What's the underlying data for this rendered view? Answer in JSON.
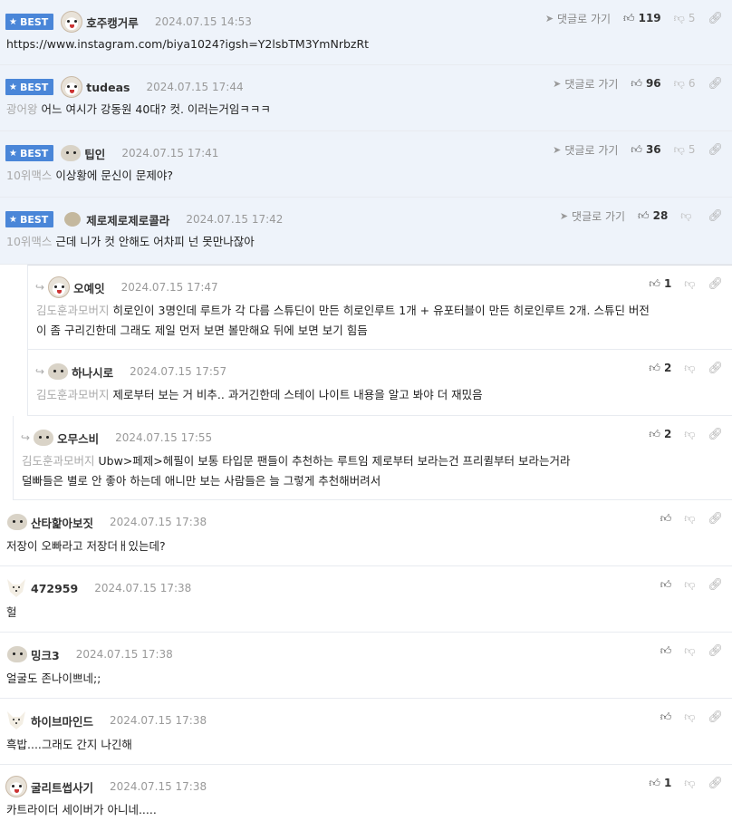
{
  "comments": [
    {
      "best": true,
      "nick": "호주캥거루",
      "date": "2024.07.15 14:53",
      "goto": "댓글로 가기",
      "up": "119",
      "down": "5",
      "tag": "",
      "text": "https://www.instagram.com/biya1024?igsh=Y2lsbTM3YmNrbzRt",
      "text2": ""
    },
    {
      "best": true,
      "nick": "tudeas",
      "date": "2024.07.15 17:44",
      "goto": "댓글로 가기",
      "up": "96",
      "down": "6",
      "tag": "광어왕",
      "text": "어느 여시가 강동원 40대? 컷. 이러는거임ㅋㅋㅋ",
      "text2": ""
    },
    {
      "best": true,
      "nick": "팁인",
      "date": "2024.07.15 17:41",
      "goto": "댓글로 가기",
      "up": "36",
      "down": "5",
      "tag": "10위맥스",
      "text": "이상황에 문신이 문제야?",
      "text2": ""
    },
    {
      "best": true,
      "nick": "제로제로제로콜라",
      "date": "2024.07.15 17:42",
      "goto": "댓글로 가기",
      "up": "28",
      "down": "",
      "tag": "10위맥스",
      "text": "근데 니가 컷 안해도 어차피 넌 못만나잖아",
      "text2": ""
    },
    {
      "best": false,
      "nick": "오예잇",
      "date": "2024.07.15 17:47",
      "goto": "",
      "up": "1",
      "down": "",
      "tag": "김도훈과모버지",
      "text": "히로인이 3명인데 루트가 각 다름 스튜딘이 만든 히로인루트 1개 + 유포터블이 만든 히로인루트 2개. 스튜딘 버전",
      "text2": "이 좀 구리긴한데 그래도 제일 먼저 보면 볼만해요 뒤에 보면 보기 힘듬"
    },
    {
      "best": false,
      "nick": "하나시로",
      "date": "2024.07.15 17:57",
      "goto": "",
      "up": "2",
      "down": "",
      "tag": "김도훈과모버지",
      "text": "제로부터 보는 거 비추.. 과거긴한데 스테이 나이트 내용을 알고 봐야 더 재밌음",
      "text2": ""
    },
    {
      "best": false,
      "nick": "오무스비",
      "date": "2024.07.15 17:55",
      "goto": "",
      "up": "2",
      "down": "",
      "tag": "김도훈과모버지",
      "text": "Ubw>페제>헤필이 보통 타입문 팬들이 추천하는 루트임 제로부터 보라는건 프리퀼부터 보라는거라",
      "text2": "덜빠들은 별로 안 좋아 하는데 애니만 보는 사람들은 늘 그렇게 추천해버려서"
    },
    {
      "best": false,
      "nick": "산타핥아보짓",
      "date": "2024.07.15 17:38",
      "goto": "",
      "up": "",
      "down": "",
      "tag": "",
      "text": "저장이 오빠라고 저장더ㅐ있는데?",
      "text2": ""
    },
    {
      "best": false,
      "nick": "472959",
      "date": "2024.07.15 17:38",
      "goto": "",
      "up": "",
      "down": "",
      "tag": "",
      "text": "헐",
      "text2": ""
    },
    {
      "best": false,
      "nick": "밍크3",
      "date": "2024.07.15 17:38",
      "goto": "",
      "up": "",
      "down": "",
      "tag": "",
      "text": "얼굴도 존나이쁘네;;",
      "text2": ""
    },
    {
      "best": false,
      "nick": "하이브마인드",
      "date": "2024.07.15 17:38",
      "goto": "",
      "up": "",
      "down": "",
      "tag": "",
      "text": "흑밥....그래도 간지 나긴해",
      "text2": ""
    },
    {
      "best": false,
      "nick": "굴리트썹사기",
      "date": "2024.07.15 17:38",
      "goto": "",
      "up": "1",
      "down": "",
      "tag": "",
      "text": "카트라이더 세이버가 아니네.....",
      "text2": ""
    }
  ],
  "labels": {
    "best": "BEST"
  },
  "icons": {
    "up": "thumbs-up-icon",
    "down": "thumbs-down-icon",
    "link": "link-icon",
    "goto": "send-arrow-icon",
    "reply": "reply-arrow-icon",
    "star": "star-icon"
  },
  "colors": {
    "best_bg": "#eef3fa",
    "badge": "#4a86d8"
  }
}
